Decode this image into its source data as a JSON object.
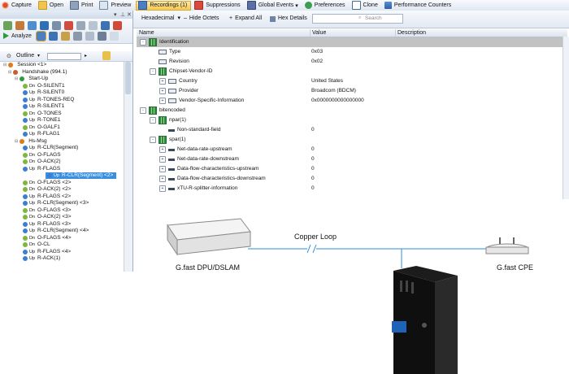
{
  "toolbar": {
    "capture": "Capture",
    "open": "Open",
    "print": "Print",
    "preview": "Preview",
    "recordings": "Recordings (1)",
    "suppressions": "Suppressions",
    "global_events": "Global Events",
    "preferences": "Preferences",
    "clone": "Clone",
    "performance_counters": "Performance Counters"
  },
  "left_panel": {
    "analyze_label": "Analyze",
    "outline_label": "Outline",
    "tree": [
      {
        "text": "Session <1>",
        "tag": "",
        "color": "#e07b18",
        "level": 0
      },
      {
        "text": "Handshake (994.1)",
        "tag": "",
        "color": "#c85e2a",
        "level": 1
      },
      {
        "text": "Start-Up",
        "tag": "",
        "color": "#2f9b41",
        "level": 2
      },
      {
        "text": "O-SILENT1",
        "tag": "Dn",
        "color": "#7cb83a",
        "level": 3
      },
      {
        "text": "R-SILENT0",
        "tag": "Up",
        "color": "#3c7fd1",
        "level": 3
      },
      {
        "text": "R-TONES-REQ",
        "tag": "Up",
        "color": "#3c7fd1",
        "level": 3
      },
      {
        "text": "R-SILENT1",
        "tag": "Up",
        "color": "#3c7fd1",
        "level": 3
      },
      {
        "text": "O-TONES",
        "tag": "Dn",
        "color": "#7cb83a",
        "level": 3
      },
      {
        "text": "R-TONE1",
        "tag": "Up",
        "color": "#3c7fd1",
        "level": 3
      },
      {
        "text": "O-GALF1",
        "tag": "Dn",
        "color": "#7cb83a",
        "level": 3
      },
      {
        "text": "R-FLAG1",
        "tag": "Up",
        "color": "#3c7fd1",
        "level": 3
      },
      {
        "text": "Hs-Msg",
        "tag": "",
        "color": "#e07b18",
        "level": 2
      },
      {
        "text": "R-CLR(Segment)",
        "tag": "Up",
        "color": "#3c7fd1",
        "level": 3
      },
      {
        "text": "O-FLAGS",
        "tag": "Dn",
        "color": "#7cb83a",
        "level": 3
      },
      {
        "text": "O-ACK(2)",
        "tag": "Dn",
        "color": "#7cb83a",
        "level": 3
      },
      {
        "text": "R-FLAGS",
        "tag": "Up",
        "color": "#3c7fd1",
        "level": 3
      },
      {
        "text": "R-CLR(Segment) <2>",
        "tag": "Up",
        "color": "#3c7fd1",
        "level": 3,
        "selected": true
      },
      {
        "text": "O-FLAGS <2>",
        "tag": "Dn",
        "color": "#7cb83a",
        "level": 3
      },
      {
        "text": "O-ACK(2) <2>",
        "tag": "Dn",
        "color": "#7cb83a",
        "level": 3
      },
      {
        "text": "R-FLAGS <2>",
        "tag": "Up",
        "color": "#3c7fd1",
        "level": 3
      },
      {
        "text": "R-CLR(Segment) <3>",
        "tag": "Up",
        "color": "#3c7fd1",
        "level": 3
      },
      {
        "text": "O-FLAGS <3>",
        "tag": "Dn",
        "color": "#7cb83a",
        "level": 3
      },
      {
        "text": "O-ACK(2) <3>",
        "tag": "Dn",
        "color": "#7cb83a",
        "level": 3
      },
      {
        "text": "R-FLAGS <3>",
        "tag": "Up",
        "color": "#3c7fd1",
        "level": 3
      },
      {
        "text": "R-CLR(Segment) <4>",
        "tag": "Up",
        "color": "#3c7fd1",
        "level": 3
      },
      {
        "text": "O-FLAGS <4>",
        "tag": "Dn",
        "color": "#7cb83a",
        "level": 3
      },
      {
        "text": "O-CL",
        "tag": "Dn",
        "color": "#7cb83a",
        "level": 3
      },
      {
        "text": "R-FLAGS <4>",
        "tag": "Up",
        "color": "#3c7fd1",
        "level": 3
      },
      {
        "text": "R-ACK(1)",
        "tag": "Up",
        "color": "#3c7fd1",
        "level": 3
      }
    ]
  },
  "right_bar": {
    "hexadecimal": "Hexadecimal",
    "hide_octets": "Hide Octets",
    "expand_all": "Expand All",
    "hex_details": "Hex Details",
    "search_placeholder": "Search"
  },
  "grid": {
    "columns": [
      "Name",
      "Value",
      "Description"
    ],
    "rows": [
      {
        "name": "Identification",
        "value": "",
        "icon": "group",
        "indent": 0,
        "expander": "-",
        "selected": true
      },
      {
        "name": "Type",
        "value": "0x03",
        "icon": "leaf",
        "indent": 1,
        "expander": ""
      },
      {
        "name": "Revision",
        "value": "0x02",
        "icon": "leaf",
        "indent": 1,
        "expander": ""
      },
      {
        "name": "Chipset-Vendor-ID",
        "value": "",
        "icon": "group",
        "indent": 1,
        "expander": "-"
      },
      {
        "name": "Country",
        "value": "United States",
        "icon": "leaf",
        "indent": 2,
        "expander": "+"
      },
      {
        "name": "Provider",
        "value": "Broadcom (BDCM)",
        "icon": "leaf",
        "indent": 2,
        "expander": "+"
      },
      {
        "name": "Vendor-Specific-Information",
        "value": "0x0000000000000000",
        "icon": "leaf",
        "indent": 2,
        "expander": "+"
      },
      {
        "name": "bitencoded",
        "value": "",
        "icon": "group",
        "indent": 0,
        "expander": "-"
      },
      {
        "name": "npar(1)",
        "value": "",
        "icon": "group",
        "indent": 1,
        "expander": "-"
      },
      {
        "name": "Non-standard-field",
        "value": "0",
        "icon": "dash",
        "indent": 2,
        "expander": ""
      },
      {
        "name": "spar(1)",
        "value": "",
        "icon": "group",
        "indent": 1,
        "expander": "-"
      },
      {
        "name": "Net-data-rate-upstream",
        "value": "0",
        "icon": "dash",
        "indent": 2,
        "expander": "+"
      },
      {
        "name": "Net-data-rate-downstream",
        "value": "0",
        "icon": "dash",
        "indent": 2,
        "expander": "+"
      },
      {
        "name": "Data-flow-characteristics-upstream",
        "value": "0",
        "icon": "dash",
        "indent": 2,
        "expander": "+"
      },
      {
        "name": "Data-flow-characteristics-downstream",
        "value": "0",
        "icon": "dash",
        "indent": 2,
        "expander": "+"
      },
      {
        "name": "xTU-R-splitter-information",
        "value": "0",
        "icon": "dash",
        "indent": 2,
        "expander": "+"
      }
    ]
  },
  "diagram": {
    "dpu_label": "G.fast DPU/DSLAM",
    "loop_label": "Copper Loop",
    "cpe_label": "G.fast CPE"
  }
}
